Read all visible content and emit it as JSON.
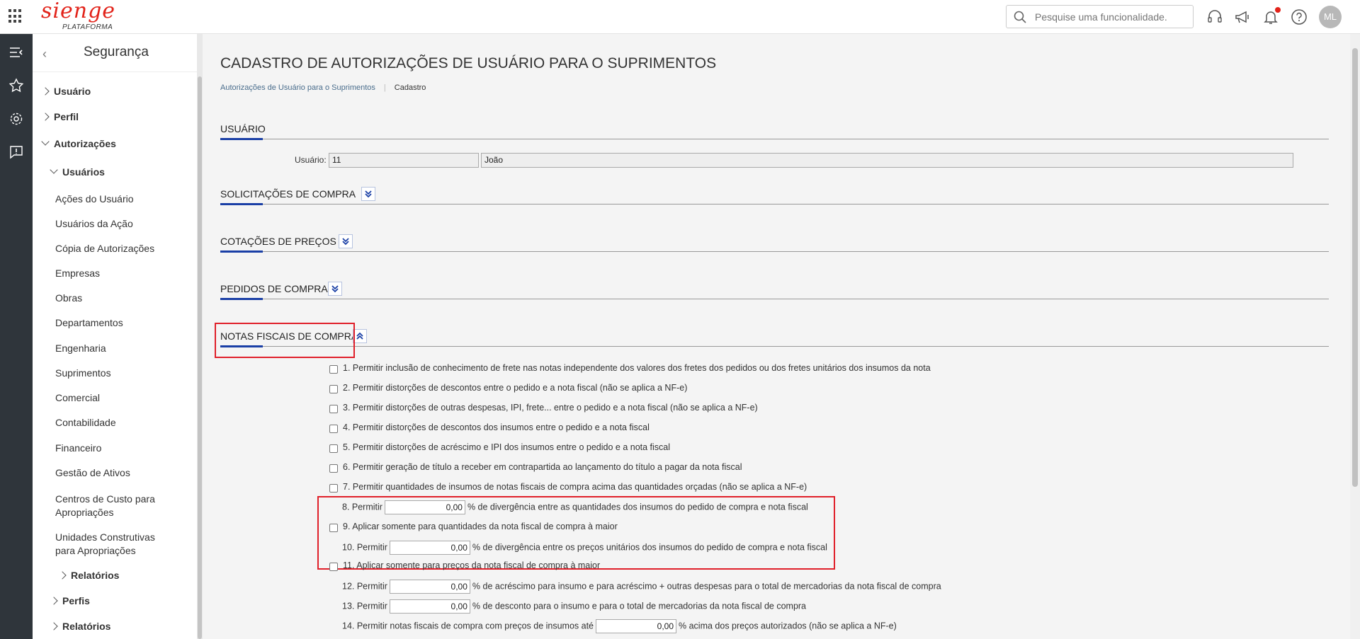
{
  "header": {
    "logo_text": "sienge",
    "logo_sub": "PLATAFORMA",
    "search_placeholder": "Pesquise uma funcionalidade.",
    "avatar": "ML",
    "accent": "#e2231a"
  },
  "sidebar": {
    "title": "Segurança",
    "items": [
      {
        "label": "Usuário"
      },
      {
        "label": "Perfil"
      },
      {
        "label": "Autorizações"
      },
      {
        "label": "Usuários"
      },
      {
        "label": "Ações do Usuário"
      },
      {
        "label": "Usuários da Ação"
      },
      {
        "label": "Cópia de Autorizações"
      },
      {
        "label": "Empresas"
      },
      {
        "label": "Obras"
      },
      {
        "label": "Departamentos"
      },
      {
        "label": "Engenharia"
      },
      {
        "label": "Suprimentos"
      },
      {
        "label": "Comercial"
      },
      {
        "label": "Contabilidade"
      },
      {
        "label": "Financeiro"
      },
      {
        "label": "Gestão de Ativos"
      },
      {
        "label": "Centros de Custo para"
      },
      {
        "label": "Apropriações"
      },
      {
        "label": "Unidades Construtivas"
      },
      {
        "label": "para Apropriações"
      },
      {
        "label": "Relatórios"
      },
      {
        "label": "Perfis"
      },
      {
        "label": "Relatórios"
      }
    ]
  },
  "page": {
    "title": "CADASTRO DE AUTORIZAÇÕES DE USUÁRIO PARA O SUPRIMENTOS",
    "breadcrumb": [
      "Autorizações de Usuário para o Suprimentos",
      "Cadastro"
    ]
  },
  "sections": {
    "usuario": "USUÁRIO",
    "solicitacoes": "SOLICITAÇÕES DE COMPRA",
    "cotacoes": "COTAÇÕES DE PREÇOS",
    "pedidos": "PEDIDOS DE COMPRA",
    "notas": "NOTAS FISCAIS DE COMPRA"
  },
  "user": {
    "label": "Usuário:",
    "code": "11",
    "name": "João"
  },
  "options": [
    {
      "text": "1. Permitir inclusão de conhecimento de frete nas notas independente dos valores dos fretes dos pedidos ou dos fretes unitários dos insumos da nota"
    },
    {
      "text": "2. Permitir distorções de descontos entre o pedido e a nota fiscal (não se aplica a NF-e)"
    },
    {
      "text": "3. Permitir distorções de outras despesas, IPI, frete... entre o pedido e a nota fiscal (não se aplica a NF-e)"
    },
    {
      "text": "4. Permitir distorções de descontos dos insumos entre o pedido e a nota fiscal"
    },
    {
      "text": "5. Permitir distorções de acréscimo e IPI dos insumos entre o pedido e a nota fiscal"
    },
    {
      "text": "6. Permitir geração de título a receber em contrapartida ao lançamento do título a pagar da nota fiscal"
    },
    {
      "text": "7. Permitir quantidades de insumos de notas fiscais de compra acima das quantidades orçadas (não se aplica a NF-e)"
    },
    {
      "pre": "8. Permitir",
      "value": "0,00",
      "post": "% de divergência entre as quantidades dos insumos do pedido de compra e nota fiscal"
    },
    {
      "text": "9. Aplicar somente para quantidades da nota fiscal de compra à maior"
    },
    {
      "pre": "10. Permitir",
      "value": "0,00",
      "post": "% de divergência entre os preços unitários dos insumos do pedido de compra e nota fiscal"
    },
    {
      "text": "11. Aplicar somente para preços da nota fiscal de compra à maior"
    },
    {
      "pre": "12. Permitir",
      "value": "0,00",
      "post": "% de acréscimo para insumo e para acréscimo + outras despesas para o total de mercadorias da nota fiscal de compra"
    },
    {
      "pre": "13. Permitir",
      "value": "0,00",
      "post": "% de desconto para o insumo e para o total de mercadorias da nota fiscal de compra"
    },
    {
      "pre": "14. Permitir notas fiscais de compra com preços de insumos até",
      "value": "0,00",
      "post": "% acima dos preços autorizados (não se aplica a NF-e)"
    }
  ]
}
